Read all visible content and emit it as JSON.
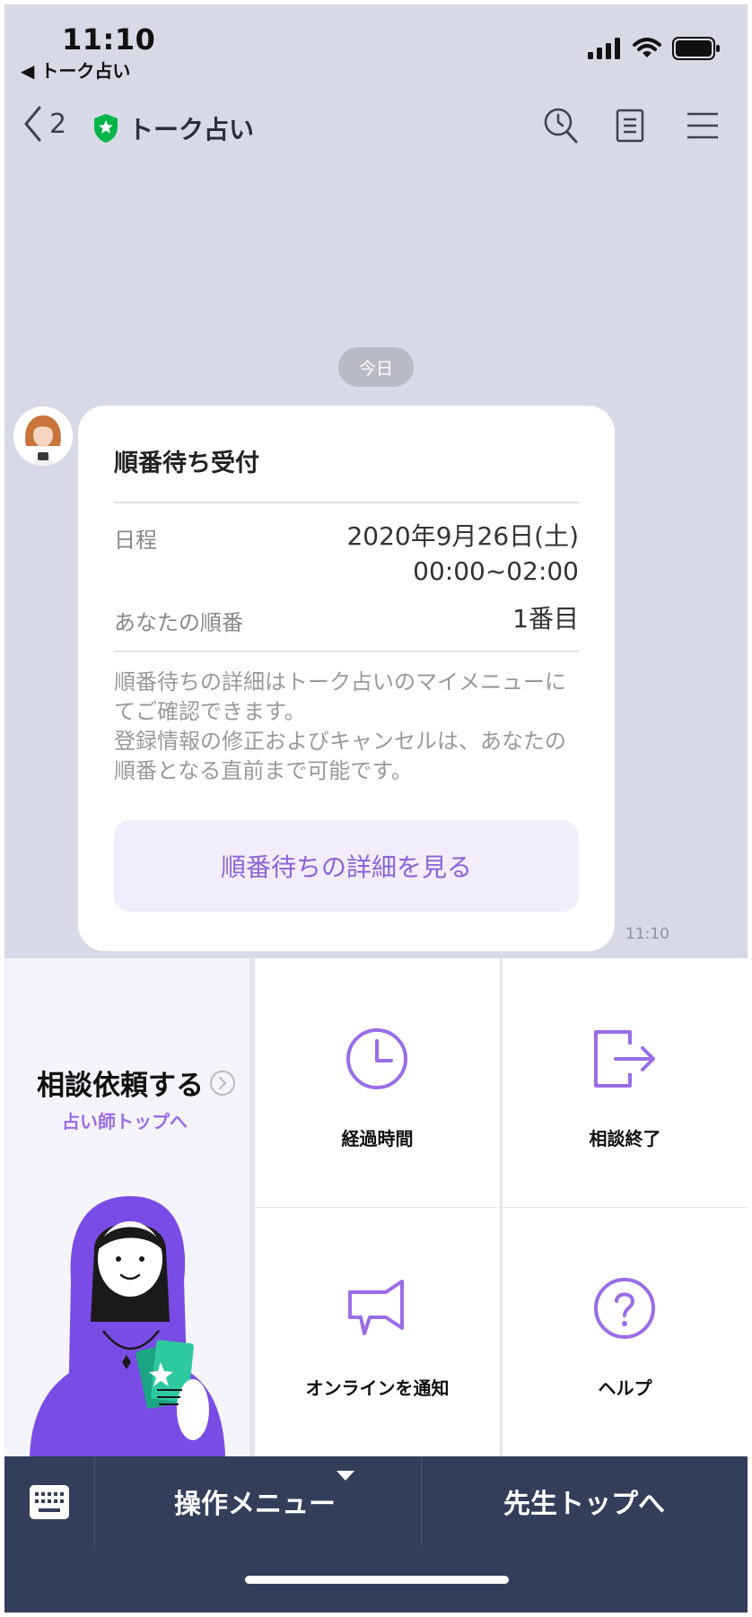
{
  "status_bar": {
    "time": "11:10",
    "back_app": "◀ トーク占い"
  },
  "nav": {
    "back_count": "2",
    "title": "トーク占い"
  },
  "chat": {
    "date_label": "今日",
    "card": {
      "title": "順番待ち受付",
      "schedule_label": "日程",
      "schedule_date": "2020年9月26日(土)",
      "schedule_time": "00:00~02:00",
      "order_label": "あなたの順番",
      "order_value": "1番目",
      "desc1": "順番待ちの詳細はトーク占いのマイメニューにてご確認できます。",
      "desc2": "登録情報の修正およびキャンセルは、あなたの順番となる直前まで可能です。",
      "button": "順番待ちの詳細を見る"
    },
    "time": "11:10"
  },
  "rich_menu": {
    "consult_title": "相談依頼する",
    "consult_sub": "占い師トップへ",
    "items": [
      {
        "label": "経過時間",
        "icon": "clock-icon"
      },
      {
        "label": "相談終了",
        "icon": "exit-icon"
      },
      {
        "label": "オンラインを通知",
        "icon": "megaphone-icon"
      },
      {
        "label": "ヘルプ",
        "icon": "help-icon"
      }
    ]
  },
  "bottom_bar": {
    "menu_label": "操作メニュー",
    "top_label": "先生トップへ"
  },
  "colors": {
    "accent": "#8d63d6",
    "bar": "#333e5a",
    "chat_bg": "#d7dae6"
  }
}
